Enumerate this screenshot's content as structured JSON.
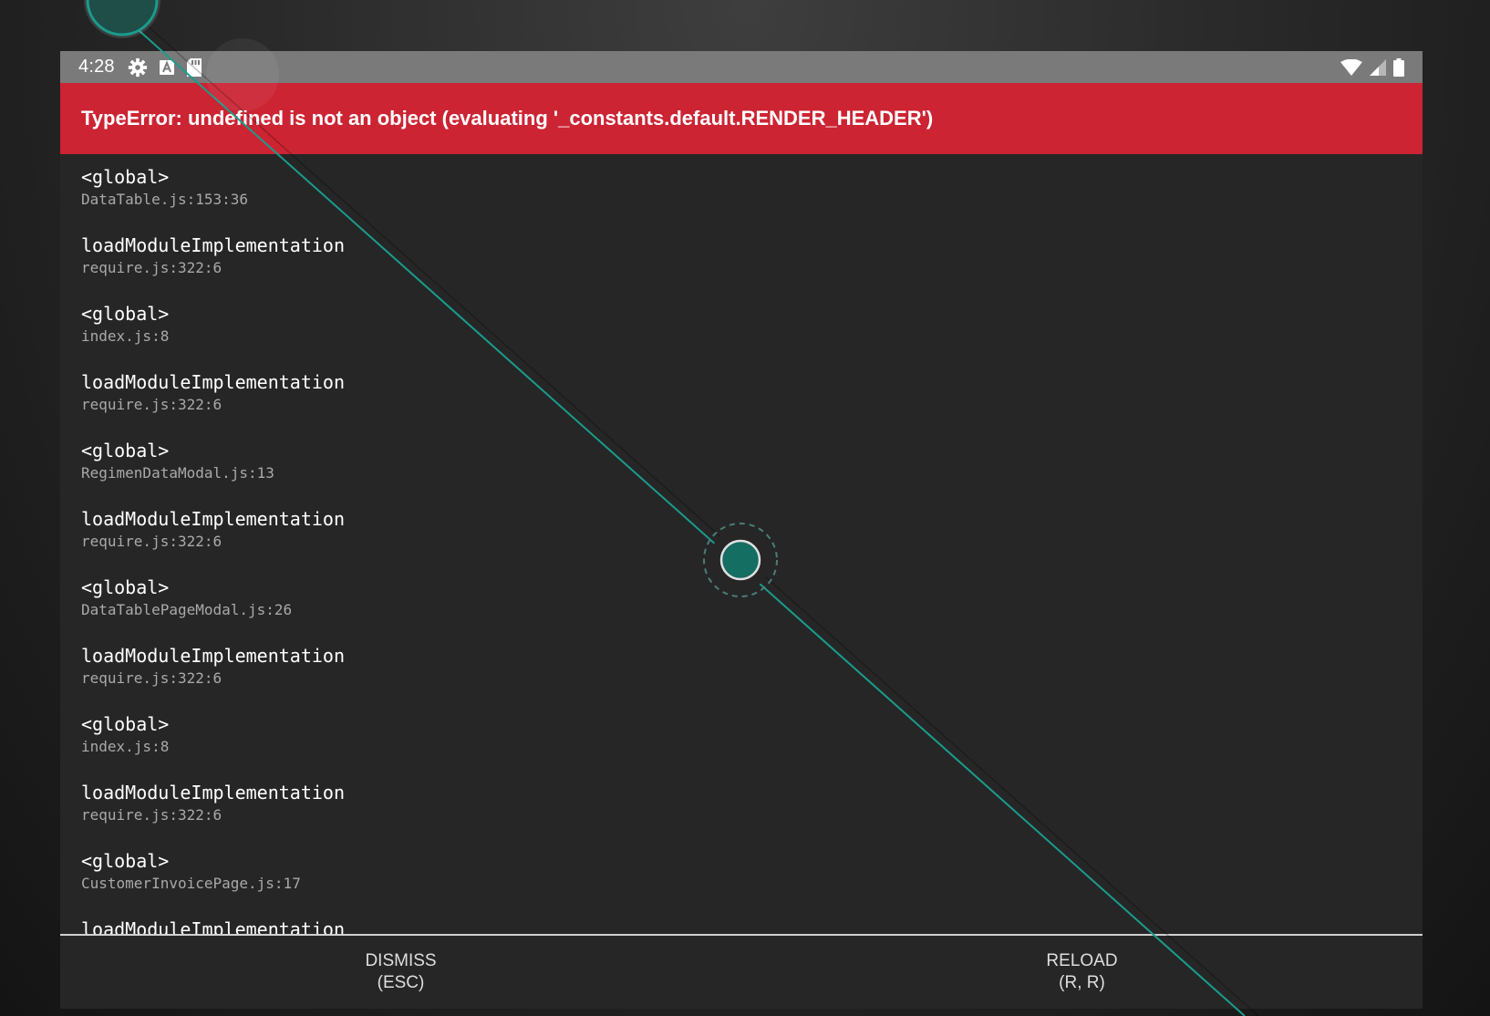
{
  "status_bar": {
    "time": "4:28",
    "left_icons": [
      "gear-icon",
      "a-box-icon",
      "sd-card-icon"
    ],
    "right_icons": [
      "wifi-icon",
      "signal-icon",
      "battery-icon"
    ]
  },
  "error": {
    "message": "TypeError: undefined is not an object (evaluating '_constants.default.RENDER_HEADER')"
  },
  "stack": [
    {
      "method": "<global>",
      "file": "DataTable.js:153:36"
    },
    {
      "method": "loadModuleImplementation",
      "file": "require.js:322:6"
    },
    {
      "method": "<global>",
      "file": "index.js:8"
    },
    {
      "method": "loadModuleImplementation",
      "file": "require.js:322:6"
    },
    {
      "method": "<global>",
      "file": "RegimenDataModal.js:13"
    },
    {
      "method": "loadModuleImplementation",
      "file": "require.js:322:6"
    },
    {
      "method": "<global>",
      "file": "DataTablePageModal.js:26"
    },
    {
      "method": "loadModuleImplementation",
      "file": "require.js:322:6"
    },
    {
      "method": "<global>",
      "file": "index.js:8"
    },
    {
      "method": "loadModuleImplementation",
      "file": "require.js:322:6"
    },
    {
      "method": "<global>",
      "file": "CustomerInvoicePage.js:17"
    },
    {
      "method": "loadModuleImplementation",
      "file": ""
    }
  ],
  "footer": {
    "dismiss": {
      "line1": "DISMISS",
      "line2": "(ESC)"
    },
    "reload": {
      "line1": "RELOAD",
      "line2": "(R, R)"
    }
  },
  "colors": {
    "error_header": "#cc2433",
    "status_bar": "#7a7a7a",
    "background": "#262626",
    "touch_indicator": "#146e62",
    "touch_line": "#1a9c8c"
  }
}
